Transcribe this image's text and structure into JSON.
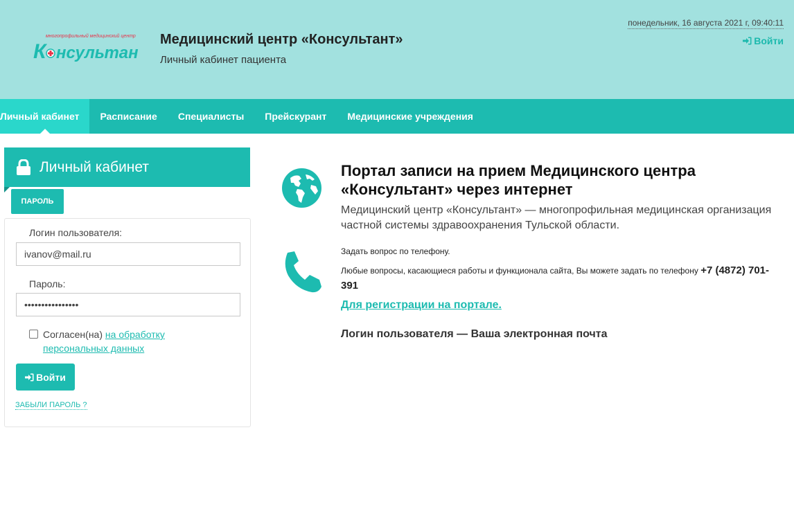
{
  "header": {
    "logo_small_text": "многопрофильный медицинский центр",
    "logo_text": "Консультант",
    "title": "Медицинский центр «Консультант»",
    "subtitle": "Личный кабинет пациента",
    "datetime": "понедельник, 16 августа 2021 г, 09:40:11",
    "login_label": "Войти"
  },
  "nav": {
    "items": [
      {
        "label": "Личный кабинет"
      },
      {
        "label": "Расписание"
      },
      {
        "label": "Специалисты"
      },
      {
        "label": "Прейскурант"
      },
      {
        "label": "Медицинские учреждения"
      }
    ]
  },
  "panel": {
    "title": "Личный кабинет",
    "tab_label": "ПАРОЛЬ",
    "login_label": "Логин пользователя:",
    "login_value": "ivanov@mail.ru",
    "password_label": "Пароль:",
    "password_value": "••••••••••••••••",
    "consent_text": "Согласен(на)",
    "consent_link": "на обработку персональных данных",
    "submit_label": "Войти",
    "forgot_label": "ЗАБЫЛИ ПАРОЛЬ ?"
  },
  "content": {
    "title": "Портал записи на прием Медицинского центра «Консультант» через интернет",
    "description": "Медицинский центр «Консультант» — многопрофильная медицинская организация частной системы здравоохранения Тульской области.",
    "ask_phone": "Задать вопрос по телефону.",
    "phone_text": "Любые вопросы, касающиеся работы и функционала сайта, Вы можете задать по телефону",
    "phone_number": "+7 (4872) 701-391",
    "register_link": "Для регистрации на портале.",
    "login_note": "Логин пользователя — Ваша электронная почта"
  },
  "colors": {
    "header_bg": "#a2e1df",
    "accent": "#1dbbb0",
    "nav_active": "#2ad7cb",
    "logo_red": "#e8334a"
  }
}
